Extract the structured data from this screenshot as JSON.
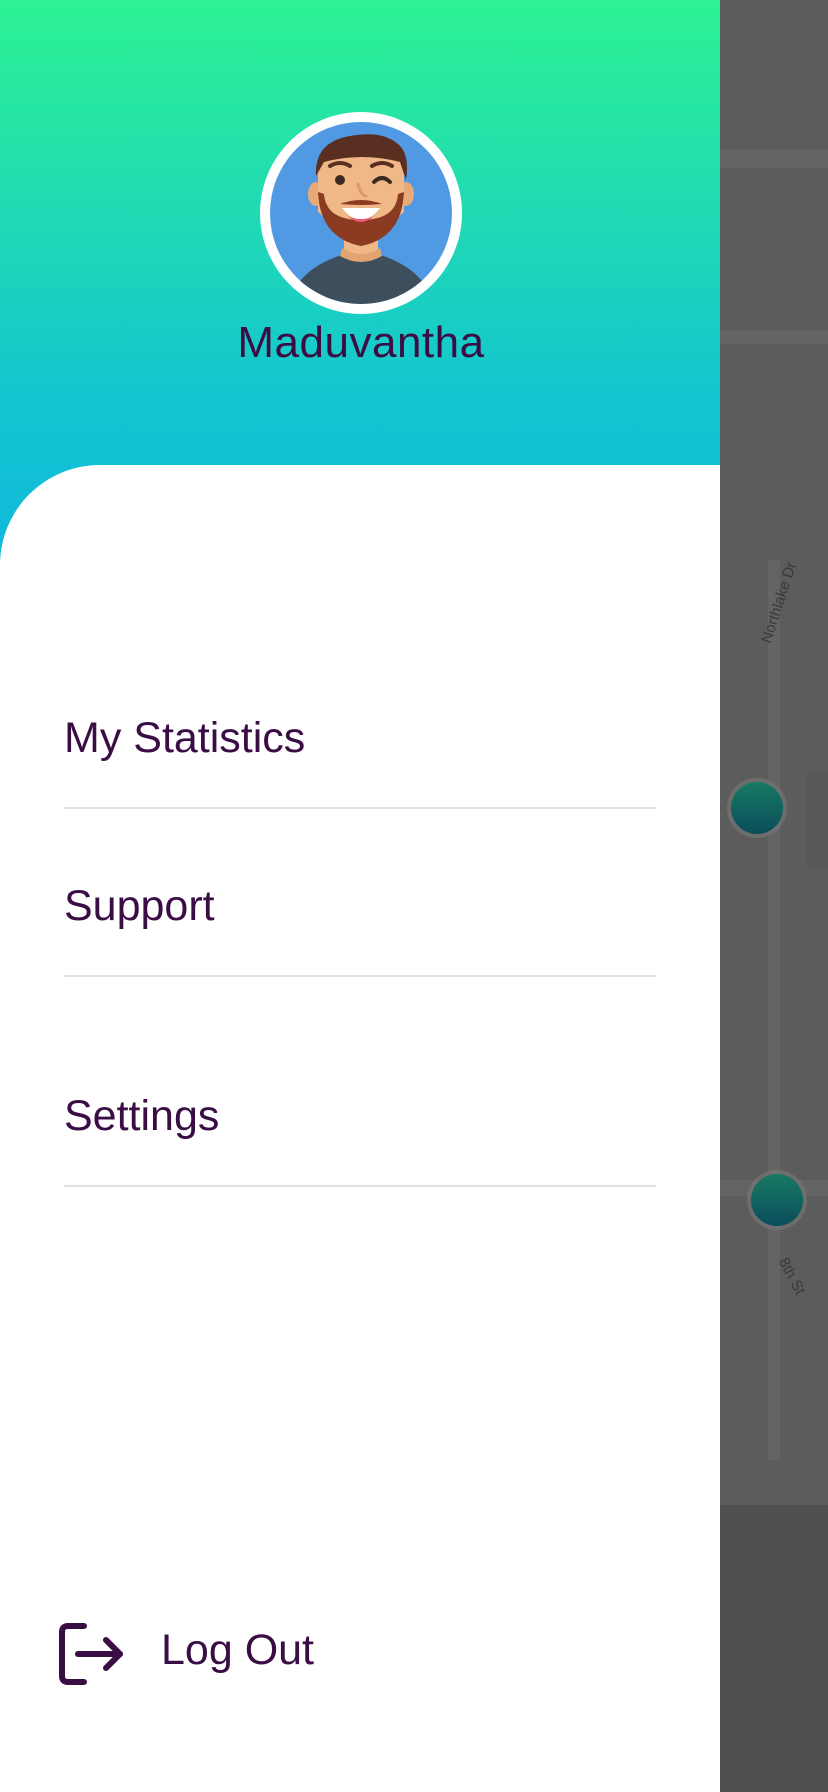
{
  "user": {
    "name": "Maduvantha",
    "avatar_icon": "winking-bearded-man-avatar"
  },
  "menu": {
    "items": [
      {
        "label": "My Statistics"
      },
      {
        "label": "Support"
      },
      {
        "label": "Settings"
      }
    ],
    "logout": {
      "label": "Log Out",
      "icon": "logout-icon"
    }
  },
  "map": {
    "labels": [
      "Northlake Dr",
      "8th St"
    ]
  },
  "colors": {
    "header_gradient_top": "#2df293",
    "header_gradient_bottom": "#0fb8dc",
    "text": "#3b0d45",
    "divider": "#e1e1e1",
    "backdrop": "#4f4f4f",
    "marker": "#0b4d5c"
  }
}
